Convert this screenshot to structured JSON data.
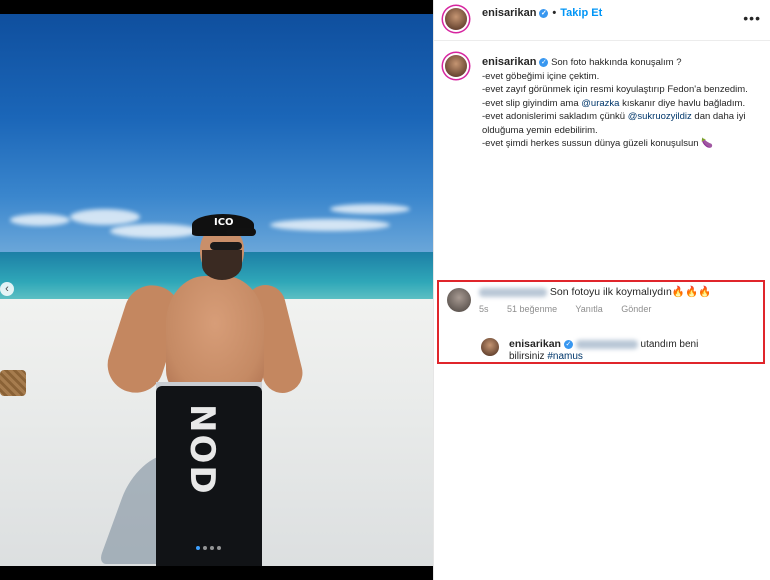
{
  "header": {
    "username": "enisarikan",
    "verified_icon": "verified-badge-icon",
    "separator": "•",
    "follow_label": "Takip Et",
    "more_icon": "more-options-icon",
    "more_label": "•••"
  },
  "caption": {
    "username": "enisarikan",
    "line1": "Son foto hakkında konuşalım ?",
    "line2": "-evet göbeğimi içine çektim.",
    "line3": "-evet zayıf görünmek için resmi koyulaştırıp Fedon'a benzedim.",
    "line4_a": "-evet slip giyindim ama",
    "line4_mention": "@urazka",
    "line4_b": "kıskanır diye havlu bağladım.",
    "line5_a": "-evet adonislerimi sakladım çünkü",
    "line5_mention": "@sukruozyildiz",
    "line5_b": "dan daha iyi",
    "line6": "olduğuma yemin edebilirim.",
    "line7": "-evet şimdi herkes sussun dünya güzeli konuşulsun 🍆"
  },
  "comment": {
    "text": "Son fotoyu ilk koymalıydın🔥🔥🔥",
    "time": "5s",
    "likes": "51 beğenme",
    "reply": "Yanıtla",
    "send": "Gönder"
  },
  "reply": {
    "username": "enisarikan",
    "text_a": "utandım beni",
    "text_b": "bilirsiniz",
    "hashtag": "#namus"
  },
  "photo": {
    "cap_text": "ICO",
    "towel_text": "NOD",
    "prev_label": "‹"
  },
  "colors": {
    "accent": "#0095f6",
    "highlight_border": "#e0252b",
    "verified": "#3897f0"
  }
}
